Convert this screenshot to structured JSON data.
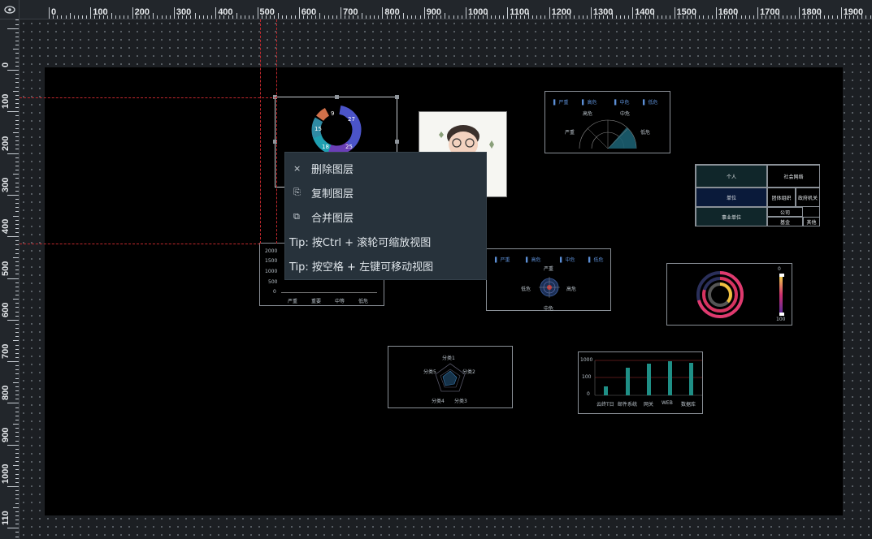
{
  "ruler": {
    "h_labels": [
      "0",
      "100",
      "200",
      "300",
      "400",
      "500",
      "600",
      "700",
      "800",
      "900",
      "1000",
      "1100",
      "1200",
      "1300",
      "1400",
      "1500",
      "1600",
      "1700",
      "1800",
      "1900"
    ],
    "v_labels": [
      "0",
      "100",
      "200",
      "300",
      "400",
      "500",
      "600",
      "700",
      "800",
      "900",
      "1000",
      "110"
    ]
  },
  "context_menu": {
    "items": [
      {
        "icon": "close-icon",
        "glyph": "×",
        "label": "删除图层"
      },
      {
        "icon": "copy-icon",
        "glyph": "⎘",
        "label": "复制图层"
      },
      {
        "icon": "merge-icon",
        "glyph": "⧉",
        "label": "合并图层"
      }
    ],
    "tips": [
      "Tip: 按Ctrl + 滚轮可缩放视图",
      "Tip: 按空格 + 左键可移动视图"
    ]
  },
  "donut": {
    "labels": [
      "9",
      "27",
      "15",
      "18",
      "25"
    ]
  },
  "bar_small": {
    "y_ticks": [
      "2000",
      "1500",
      "1000",
      "500",
      "0"
    ],
    "x_labels": [
      "严重",
      "重要",
      "中等",
      "低危"
    ]
  },
  "semi_gauge": {
    "legend": [
      "严重",
      "高危",
      "中危",
      "低危"
    ],
    "labels": [
      "高危",
      "中危",
      "严重",
      "低危"
    ]
  },
  "polar": {
    "legend": [
      "严重",
      "高危",
      "中危",
      "低危"
    ],
    "labels": [
      "严重",
      "低危",
      "高危",
      "中危"
    ]
  },
  "radar": {
    "labels": [
      "分类1",
      "分类2",
      "分类3",
      "分类4",
      "分类5"
    ]
  },
  "bar_chart": {
    "y_ticks": [
      "1000",
      "100",
      "0"
    ],
    "x_labels": [
      "云终T日",
      "邮件系统",
      "网关",
      "WEB",
      "数据库"
    ],
    "accent": "#1f8f86"
  },
  "table": {
    "cells": [
      "个人",
      "社会网络",
      "单位",
      "团体组织",
      "政府机关",
      "公司",
      "事业单位",
      "基金",
      "其他"
    ]
  },
  "ring_chart": {
    "legend_top": "0",
    "legend_bottom": "100"
  },
  "colors": {
    "canvas": "#000000",
    "guide": "#c0282d",
    "menu_bg": "#27323b"
  }
}
